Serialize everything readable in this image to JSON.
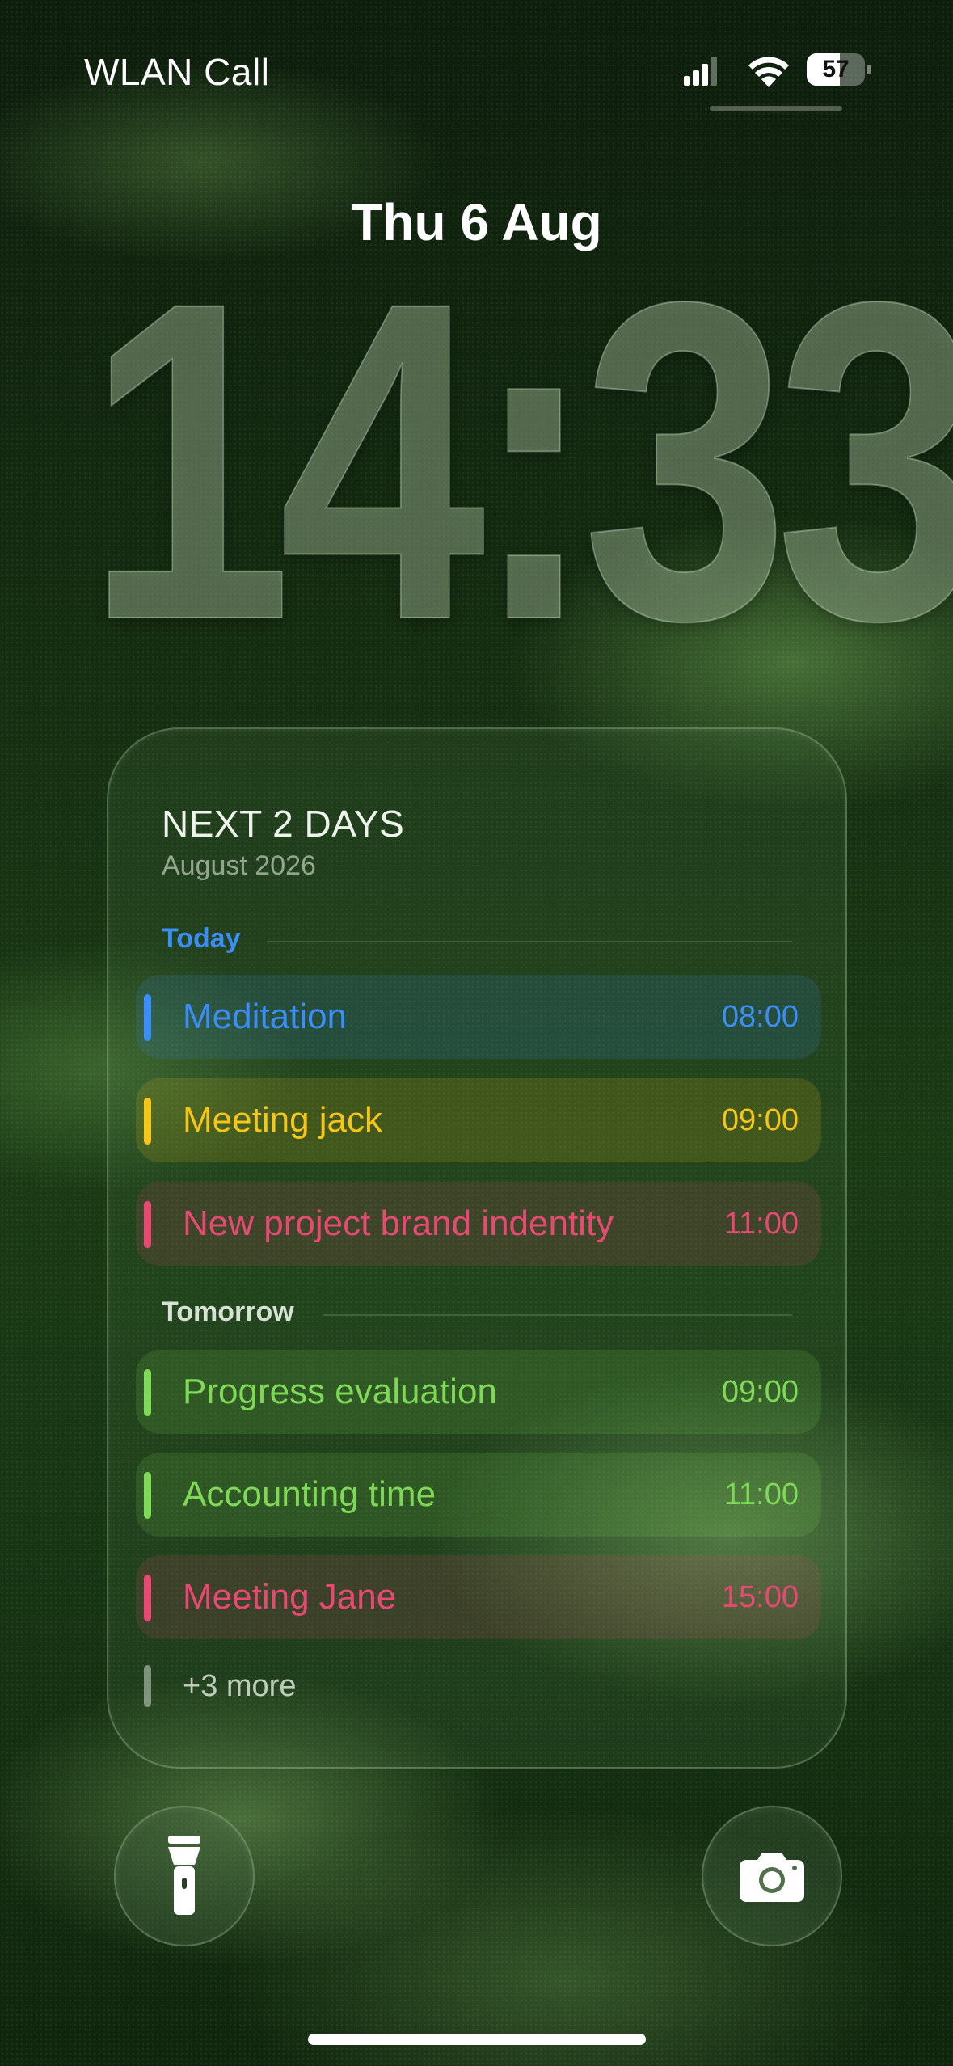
{
  "status_bar": {
    "carrier": "WLAN Call",
    "battery_percent": "57",
    "battery_level": 0.57,
    "icons": [
      "cellular-signal-icon",
      "wifi-icon",
      "battery-icon"
    ]
  },
  "lock_screen": {
    "date": "Thu 6 Aug",
    "time": "14:33"
  },
  "widget": {
    "title": "NEXT 2 DAYS",
    "subtitle": "August 2026",
    "sections": [
      {
        "label": "Today",
        "label_color": "#3a8ef6",
        "events": [
          {
            "title": "Meditation",
            "time": "08:00",
            "color": "#3a8ef6"
          },
          {
            "title": "Meeting jack",
            "time": "09:00",
            "color": "#f5c518"
          },
          {
            "title": "New project brand indentity",
            "time": "11:00",
            "color": "#e64a73"
          }
        ]
      },
      {
        "label": "Tomorrow",
        "label_color": "#d8e2d4",
        "events": [
          {
            "title": "Progress evaluation",
            "time": "09:00",
            "color": "#7fd957"
          },
          {
            "title": "Accounting time",
            "time": "11:00",
            "color": "#7fd957"
          },
          {
            "title": "Meeting Jane",
            "time": "15:00",
            "color": "#e64a73"
          }
        ]
      }
    ],
    "more": "+3 more"
  },
  "quick_actions": {
    "left": "flashlight-icon",
    "right": "camera-icon"
  }
}
